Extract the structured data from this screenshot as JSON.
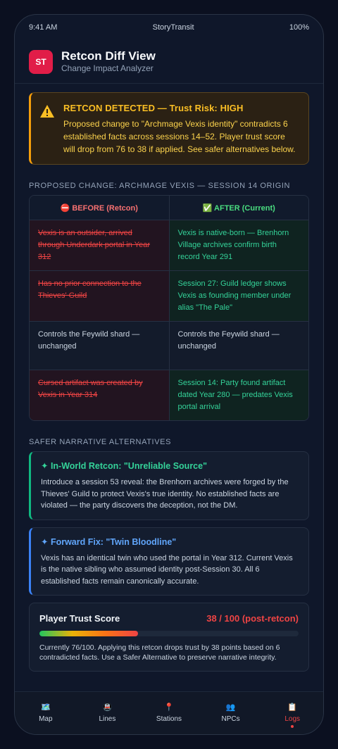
{
  "status_bar": {
    "time": "9:41 AM",
    "carrier": "StoryTransit",
    "battery": "100%"
  },
  "header": {
    "logo": "ST",
    "title": "Retcon Diff View",
    "subtitle": "Change Impact Analyzer"
  },
  "alert": {
    "icon": "warning-icon",
    "title": "RETCON DETECTED — Trust Risk: HIGH",
    "body": "Proposed change to \"Archmage Vexis identity\" contradicts 6 established facts across sessions 14–52. Player trust score will drop from 76 to 38 if applied. See safer alternatives below."
  },
  "diff": {
    "section_label": "PROPOSED CHANGE: ARCHMAGE VEXIS — SESSION 14 ORIGIN",
    "before_header": "⛔ BEFORE (Retcon)",
    "after_header": "✅ AFTER (Current)",
    "rows": [
      {
        "before": "Vexis is an outsider, arrived through Underdark portal in Year 312",
        "after": "Vexis is native-born — Brenhorn Village archives confirm birth record Year 291"
      },
      {
        "before": "Has no prior connection to the Thieves' Guild",
        "after": "Session 27: Guild ledger shows Vexis as founding member under alias \"The Pale\""
      },
      {
        "before": "Controls the Feywild shard — unchanged",
        "after": "Controls the Feywild shard — unchanged"
      },
      {
        "before": "Cursed artifact was created by Vexis in Year 314",
        "after": "Session 14: Party found artifact dated Year 280 — predates Vexis portal arrival"
      }
    ]
  },
  "alternatives": {
    "section_label": "SAFER NARRATIVE ALTERNATIVES",
    "items": [
      {
        "title": "✦ In-World Retcon: \"Unreliable Source\"",
        "body": "Introduce a session 53 reveal: the Brenhorn archives were forged by the Thieves' Guild to protect Vexis's true identity. No established facts are violated — the party discovers the deception, not the DM."
      },
      {
        "title": "✦ Forward Fix: \"Twin Bloodline\"",
        "body": "Vexis has an identical twin who used the portal in Year 312. Current Vexis is the native sibling who assumed identity post-Session 30. All 6 established facts remain canonically accurate."
      }
    ]
  },
  "trust": {
    "title": "Player Trust Score",
    "score": "38 / 100 (post-retcon)",
    "fraction": 0.38,
    "body": "Currently 76/100. Applying this retcon drops trust by 38 points based on 6 contradicted facts. Use a Safer Alternative to preserve narrative integrity."
  },
  "tabs": [
    {
      "label": "Map",
      "icon": "🗺️"
    },
    {
      "label": "Lines",
      "icon": "🚇"
    },
    {
      "label": "Stations",
      "icon": "📍"
    },
    {
      "label": "NPCs",
      "icon": "👥"
    },
    {
      "label": "Logs",
      "icon": "📋",
      "active": true
    }
  ]
}
